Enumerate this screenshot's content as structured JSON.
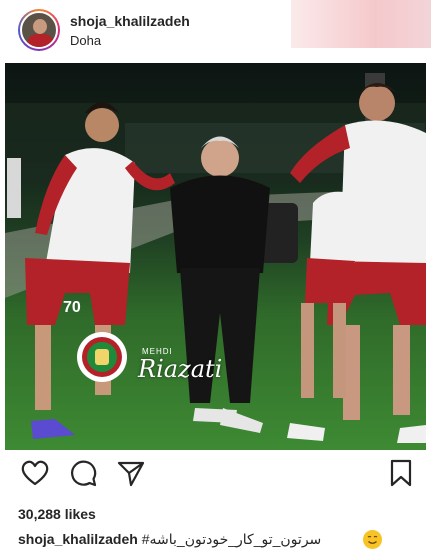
{
  "header": {
    "username": "shoja_khalilzadeh",
    "location": "Doha"
  },
  "photo": {
    "watermark_small": "MEHDI",
    "watermark_name": "Riazati",
    "shirt_number": "70"
  },
  "actions": {
    "like_icon": "heart-outline-icon",
    "comment_icon": "comment-icon",
    "share_icon": "paper-plane-icon",
    "save_icon": "bookmark-icon"
  },
  "likes": {
    "count": "30,288 likes"
  },
  "caption": {
    "username": "shoja_khalilzadeh",
    "text": "#سرتون_تو_کار_خودتون_باشه",
    "emoji": "smiling-face-emoji"
  },
  "colors": {
    "kit_red": "#b32228",
    "pitch_green": "#3e8a33",
    "text": "#262626"
  }
}
